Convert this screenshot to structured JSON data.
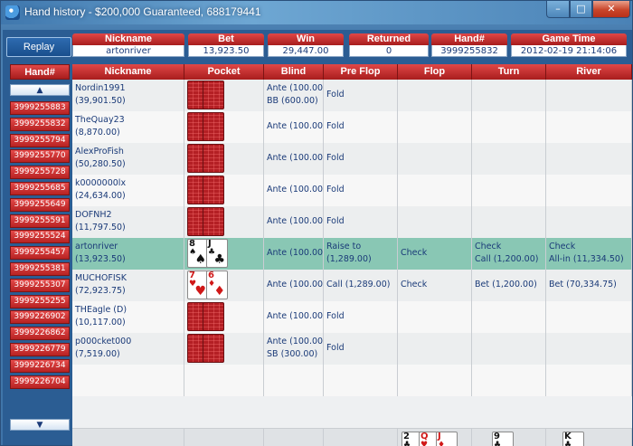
{
  "window": {
    "title": "Hand history - $200,000 Guaranteed, 688179441",
    "min_glyph": "–",
    "max_glyph": "□",
    "close_glyph": "✕"
  },
  "replay_label": "Replay",
  "summary": [
    {
      "label": "Nickname",
      "value": "artonriver"
    },
    {
      "label": "Bet",
      "value": "13,923.50"
    },
    {
      "label": "Win",
      "value": "29,447.00"
    },
    {
      "label": "Returned",
      "value": "0"
    },
    {
      "label": "Hand#",
      "value": "3999255832"
    },
    {
      "label": "Game Time",
      "value": "2012-02-19 21:14:06"
    }
  ],
  "hand_list": {
    "header": "Hand#",
    "up_glyph": "▲",
    "down_glyph": "▼",
    "items": [
      "3999255883",
      "3999255832",
      "3999255794",
      "3999255770",
      "3999255728",
      "3999255685",
      "3999255649",
      "3999255591",
      "3999255524",
      "3999255457",
      "3999255381",
      "3999255307",
      "3999255255",
      "3999226902",
      "3999226862",
      "3999226779",
      "3999226734",
      "3999226704"
    ]
  },
  "table": {
    "columns": [
      "Nickname",
      "Pocket",
      "Blind",
      "Pre Flop",
      "Flop",
      "Turn",
      "River"
    ],
    "rows": [
      {
        "name": "Nordin1991",
        "stack": "(39,901.50)",
        "blind1": "Ante (100.00)",
        "blind2": "BB (600.00)",
        "preflop1": "Fold",
        "preflop2": "",
        "flop1": "",
        "turn1": "",
        "turn2": "",
        "river1": "",
        "river2": "",
        "pocket": "back"
      },
      {
        "name": "TheQuay23",
        "stack": "(8,870.00)",
        "blind1": "Ante (100.00)",
        "blind2": "",
        "preflop1": "Fold",
        "preflop2": "",
        "flop1": "",
        "turn1": "",
        "turn2": "",
        "river1": "",
        "river2": "",
        "pocket": "back"
      },
      {
        "name": "AlexProFish",
        "stack": "(50,280.50)",
        "blind1": "Ante (100.00)",
        "blind2": "",
        "preflop1": "Fold",
        "preflop2": "",
        "flop1": "",
        "turn1": "",
        "turn2": "",
        "river1": "",
        "river2": "",
        "pocket": "back"
      },
      {
        "name": "k0000000lx",
        "stack": "(24,634.00)",
        "blind1": "Ante (100.00)",
        "blind2": "",
        "preflop1": "Fold",
        "preflop2": "",
        "flop1": "",
        "turn1": "",
        "turn2": "",
        "river1": "",
        "river2": "",
        "pocket": "back"
      },
      {
        "name": "DOFNH2",
        "stack": "(11,797.50)",
        "blind1": "Ante (100.00)",
        "blind2": "",
        "preflop1": "Fold",
        "preflop2": "",
        "flop1": "",
        "turn1": "",
        "turn2": "",
        "river1": "",
        "river2": "",
        "pocket": "back"
      },
      {
        "name": "artonriver",
        "stack": "(13,923.50)",
        "blind1": "Ante (100.00)",
        "blind2": "",
        "preflop1": "Raise to",
        "preflop2": "(1,289.00)",
        "flop1": "Check",
        "turn1": "Check",
        "turn2": "Call (1,200.00)",
        "river1": "Check",
        "river2": "All-in (11,334.50)",
        "pocket": "hero",
        "hero": true
      },
      {
        "name": "MUCHOFISK",
        "stack": "(72,923.75)",
        "blind1": "Ante (100.00)",
        "blind2": "",
        "preflop1": "Call (1,289.00)",
        "preflop2": "",
        "flop1": "Check",
        "turn1": "Bet (1,200.00)",
        "turn2": "",
        "river1": "Bet (70,334.75)",
        "river2": "",
        "pocket": "villain"
      },
      {
        "name": "THEagle (D)",
        "stack": "(10,117.00)",
        "blind1": "Ante (100.00)",
        "blind2": "",
        "preflop1": "Fold",
        "preflop2": "",
        "flop1": "",
        "turn1": "",
        "turn2": "",
        "river1": "",
        "river2": "",
        "pocket": "back"
      },
      {
        "name": "p000cket000",
        "stack": "(7,519.00)",
        "blind1": "Ante (100.00)",
        "blind2": "SB (300.00)",
        "preflop1": "Fold",
        "preflop2": "",
        "flop1": "",
        "turn1": "",
        "turn2": "",
        "river1": "",
        "river2": "",
        "pocket": "back"
      }
    ],
    "hero_cards": [
      {
        "rank": "8",
        "suit": "♠",
        "color": "black"
      },
      {
        "rank": "J",
        "suit": "♣",
        "color": "black"
      }
    ],
    "villain_cards": [
      {
        "rank": "7",
        "suit": "♥",
        "color": "red"
      },
      {
        "rank": "6",
        "suit": "♦",
        "color": "red"
      }
    ],
    "board": {
      "flop": [
        {
          "rank": "2",
          "suit": "♣",
          "color": "black"
        },
        {
          "rank": "Q",
          "suit": "♥",
          "color": "red"
        },
        {
          "rank": "J",
          "suit": "♦",
          "color": "red"
        }
      ],
      "turn": [
        {
          "rank": "9",
          "suit": "♣",
          "color": "black"
        }
      ],
      "river": [
        {
          "rank": "K",
          "suit": "♣",
          "color": "black"
        }
      ]
    }
  }
}
